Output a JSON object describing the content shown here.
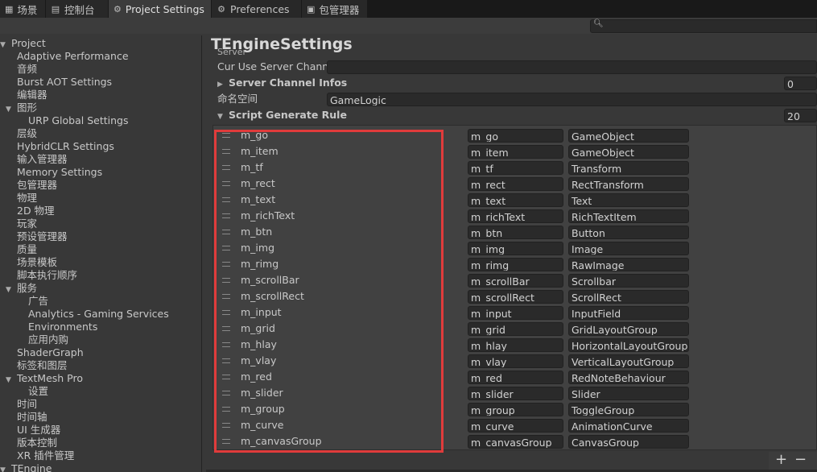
{
  "tabs": [
    {
      "label": "场景",
      "icon": "grid-icon",
      "glyph": "▦",
      "active": false
    },
    {
      "label": "控制台",
      "icon": "console-icon",
      "glyph": "▤",
      "active": false
    },
    {
      "label": "Project Settings",
      "icon": "gear-icon",
      "glyph": "⚙",
      "active": true
    },
    {
      "label": "Preferences",
      "icon": "gear-icon",
      "glyph": "⚙",
      "active": false
    },
    {
      "label": "包管理器",
      "icon": "package-icon",
      "glyph": "▣",
      "active": false
    }
  ],
  "search": {
    "placeholder": ""
  },
  "sidebar": {
    "items": [
      {
        "label": "Project",
        "indent": 0,
        "arrow": "▼"
      },
      {
        "label": "Adaptive Performance",
        "indent": 1,
        "arrow": ""
      },
      {
        "label": "音频",
        "indent": 1,
        "arrow": ""
      },
      {
        "label": "Burst AOT Settings",
        "indent": 1,
        "arrow": ""
      },
      {
        "label": "编辑器",
        "indent": 1,
        "arrow": ""
      },
      {
        "label": "图形",
        "indent": 1,
        "arrow": "▼"
      },
      {
        "label": "URP Global Settings",
        "indent": 2,
        "arrow": ""
      },
      {
        "label": "层级",
        "indent": 1,
        "arrow": ""
      },
      {
        "label": "HybridCLR Settings",
        "indent": 1,
        "arrow": ""
      },
      {
        "label": "输入管理器",
        "indent": 1,
        "arrow": ""
      },
      {
        "label": "Memory Settings",
        "indent": 1,
        "arrow": ""
      },
      {
        "label": "包管理器",
        "indent": 1,
        "arrow": ""
      },
      {
        "label": "物理",
        "indent": 1,
        "arrow": ""
      },
      {
        "label": "2D 物理",
        "indent": 1,
        "arrow": ""
      },
      {
        "label": "玩家",
        "indent": 1,
        "arrow": ""
      },
      {
        "label": "预设管理器",
        "indent": 1,
        "arrow": ""
      },
      {
        "label": "质量",
        "indent": 1,
        "arrow": ""
      },
      {
        "label": "场景模板",
        "indent": 1,
        "arrow": ""
      },
      {
        "label": "脚本执行顺序",
        "indent": 1,
        "arrow": ""
      },
      {
        "label": "服务",
        "indent": 1,
        "arrow": "▼"
      },
      {
        "label": "广告",
        "indent": 2,
        "arrow": ""
      },
      {
        "label": "Analytics - Gaming Services",
        "indent": 2,
        "arrow": ""
      },
      {
        "label": "Environments",
        "indent": 2,
        "arrow": ""
      },
      {
        "label": "应用内购",
        "indent": 2,
        "arrow": ""
      },
      {
        "label": "ShaderGraph",
        "indent": 1,
        "arrow": ""
      },
      {
        "label": "标签和图层",
        "indent": 1,
        "arrow": ""
      },
      {
        "label": "TextMesh Pro",
        "indent": 1,
        "arrow": "▼"
      },
      {
        "label": "设置",
        "indent": 2,
        "arrow": ""
      },
      {
        "label": "时间",
        "indent": 1,
        "arrow": ""
      },
      {
        "label": "时间轴",
        "indent": 1,
        "arrow": ""
      },
      {
        "label": "UI 生成器",
        "indent": 1,
        "arrow": ""
      },
      {
        "label": "版本控制",
        "indent": 1,
        "arrow": ""
      },
      {
        "label": "XR 插件管理",
        "indent": 1,
        "arrow": ""
      },
      {
        "label": "TEngine",
        "indent": 0,
        "arrow": "▼"
      }
    ]
  },
  "main": {
    "title": "TEngineSettings",
    "section_label": "Server",
    "cur_use_label": "Cur Use Server Channe",
    "cur_use_value": "",
    "server_channel_label": "Server Channel Infos",
    "server_channel_count": "0",
    "namespace_label": "命名空间",
    "namespace_value": "GameLogic",
    "rule_label": "Script Generate Rule",
    "rule_count": "20",
    "rules": [
      {
        "name": "m_go",
        "prefix": "m_go",
        "type": "GameObject"
      },
      {
        "name": "m_item",
        "prefix": "m_item",
        "type": "GameObject"
      },
      {
        "name": "m_tf",
        "prefix": "m_tf",
        "type": "Transform"
      },
      {
        "name": "m_rect",
        "prefix": "m_rect",
        "type": "RectTransform"
      },
      {
        "name": "m_text",
        "prefix": "m_text",
        "type": "Text"
      },
      {
        "name": "m_richText",
        "prefix": "m_richText",
        "type": "RichTextItem"
      },
      {
        "name": "m_btn",
        "prefix": "m_btn",
        "type": "Button"
      },
      {
        "name": "m_img",
        "prefix": "m_img",
        "type": "Image"
      },
      {
        "name": "m_rimg",
        "prefix": "m_rimg",
        "type": "RawImage"
      },
      {
        "name": "m_scrollBar",
        "prefix": "m_scrollBar",
        "type": "Scrollbar"
      },
      {
        "name": "m_scrollRect",
        "prefix": "m_scrollRect",
        "type": "ScrollRect"
      },
      {
        "name": "m_input",
        "prefix": "m_input",
        "type": "InputField"
      },
      {
        "name": "m_grid",
        "prefix": "m_grid",
        "type": "GridLayoutGroup"
      },
      {
        "name": "m_hlay",
        "prefix": "m_hlay",
        "type": "HorizontalLayoutGroup"
      },
      {
        "name": "m_vlay",
        "prefix": "m_vlay",
        "type": "VerticalLayoutGroup"
      },
      {
        "name": "m_red",
        "prefix": "m_red",
        "type": "RedNoteBehaviour"
      },
      {
        "name": "m_slider",
        "prefix": "m_slider",
        "type": "Slider"
      },
      {
        "name": "m_group",
        "prefix": "m_group",
        "type": "ToggleGroup"
      },
      {
        "name": "m_curve",
        "prefix": "m_curve",
        "type": "AnimationCurve"
      },
      {
        "name": "m_canvasGroup",
        "prefix": "m_canvasGroup",
        "type": "CanvasGroup"
      }
    ],
    "add_label": "+",
    "remove_label": "−"
  },
  "colors": {
    "highlight": "#e03b3b",
    "background": "#383838",
    "field": "#2a2a2a"
  }
}
